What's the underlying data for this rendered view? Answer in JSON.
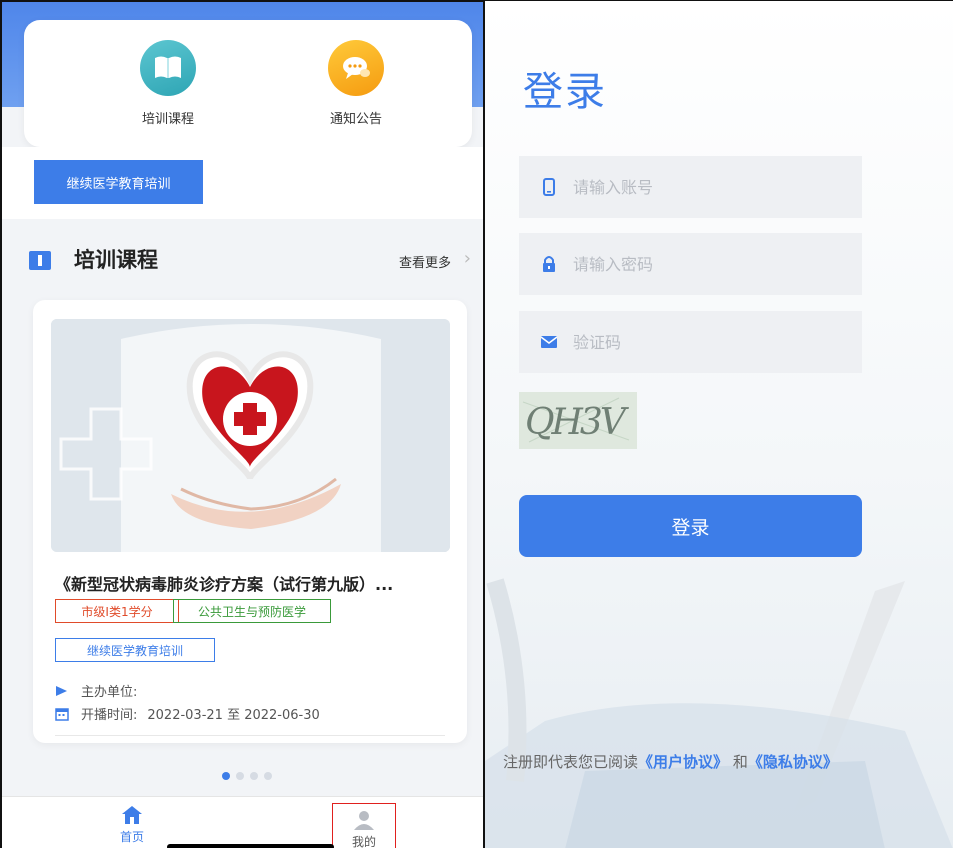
{
  "home": {
    "quick_links": [
      {
        "label": "培训课程",
        "icon": "book-icon",
        "color": "#2ea5b4"
      },
      {
        "label": "通知公告",
        "icon": "chat-bubble-icon",
        "color": "#f59b10"
      }
    ],
    "category_tab": "继续医学教育培训",
    "section": {
      "title": "培训课程",
      "more": "查看更多"
    },
    "course": {
      "title": "《新型冠状病毒肺炎诊疗方案（试行第九版）...",
      "tags": [
        "市级I类1学分",
        "公共卫生与预防医学",
        "继续医学教育培训"
      ],
      "organizer_label": "主办单位:",
      "broadcast_label": "开播时间:",
      "broadcast_time": "2022-03-21 至 2022-06-30"
    },
    "tabbar": {
      "home": "首页",
      "mine": "我的"
    }
  },
  "login": {
    "title": "登录",
    "account_placeholder": "请输入账号",
    "password_placeholder": "请输入密码",
    "captcha_placeholder": "验证码",
    "captcha_text": "QH3V",
    "button": "登录",
    "agreement": {
      "prefix": "注册即代表您已阅读",
      "user_link": "《用户协议》",
      "and": "和",
      "privacy_link": "《隐私协议》"
    }
  },
  "colors": {
    "accent": "#3d7de8",
    "tag_orange": "#e04b2a",
    "tag_green": "#3a9a3a"
  }
}
